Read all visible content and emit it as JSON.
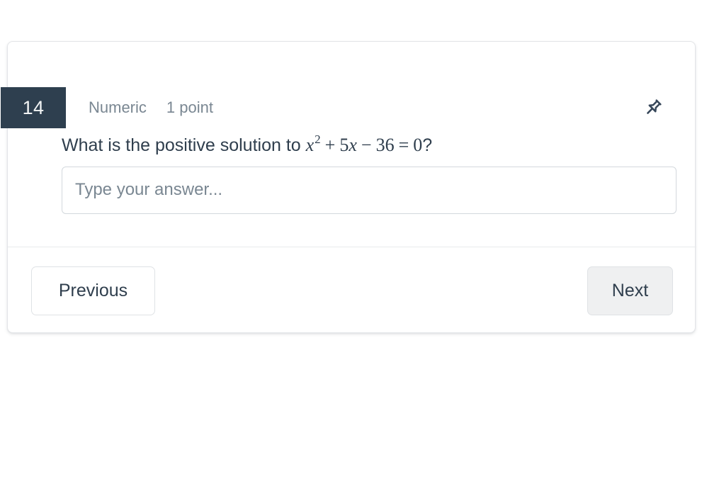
{
  "question_card": {
    "number": "14",
    "type_label": "Numeric",
    "points_label": "1 point",
    "pin_icon": "pin-icon",
    "prompt_prefix": "What is the positive solution to ",
    "prompt_suffix": "?",
    "equation": {
      "latex": "x^2 + 5x - 36 = 0",
      "variable_1": "x",
      "exponent_1": "2",
      "operator_1": "+",
      "coefficient_2": "5",
      "variable_2": "x",
      "operator_2": "−",
      "constant": "36",
      "equals": "=",
      "right_side": "0"
    },
    "answer": {
      "value": "",
      "placeholder": "Type your answer..."
    }
  },
  "footer": {
    "previous_label": "Previous",
    "next_label": "Next"
  },
  "colors": {
    "badge_background": "#2e3f4f",
    "badge_text": "#f1f3f4",
    "body_text": "#2f3e4d",
    "muted_text": "#7a8792",
    "card_border": "#e3e5e8",
    "input_border": "#d3d8dd",
    "next_button_background": "#eff0f1",
    "page_background": "#ffffff"
  }
}
